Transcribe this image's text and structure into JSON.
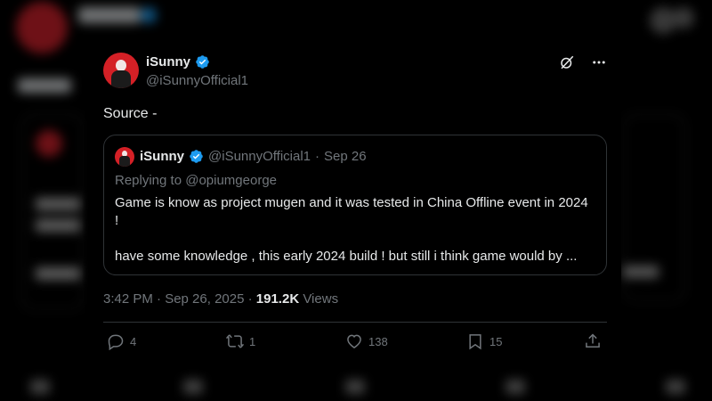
{
  "tweet": {
    "author": {
      "name": "iSunny",
      "handle": "@iSunnyOfficial1",
      "avatar_color": "#d42026",
      "verified": true
    },
    "text": "Source -",
    "quoted": {
      "name": "iSunny",
      "handle": "@iSunnyOfficial1",
      "separator": "·",
      "date": "Sep 26",
      "replying_prefix": "Replying to",
      "replying_to": "@opiumgeorge",
      "line1": "Game is know as project mugen and it was tested in China Offline event in 2024 !",
      "line2": "have some knowledge , this early 2024 build ! but still i think game would by ..."
    },
    "timestamp": "3:42 PM · Sep 26, 2025 ·",
    "views_count": "191.2K",
    "views_label": "Views",
    "stats": {
      "replies": "4",
      "reposts": "1",
      "likes": "138",
      "bookmarks": "15"
    }
  },
  "icons": {
    "grok": "grok-icon",
    "more": "more-icon",
    "verified": "verified-badge-icon",
    "reply": "reply-icon",
    "repost": "repost-icon",
    "like": "heart-icon",
    "bookmark": "bookmark-icon",
    "share": "share-icon"
  },
  "colors": {
    "background": "#000000",
    "text_primary": "#e7e9ea",
    "text_secondary": "#71767b",
    "border": "#2f3336",
    "verified": "#1d9bf0"
  }
}
